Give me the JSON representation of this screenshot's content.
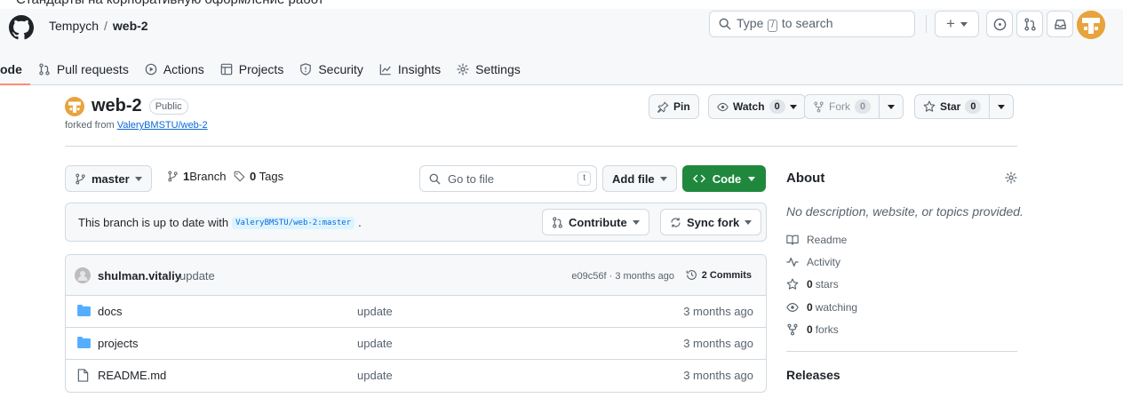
{
  "top_strip": {
    "text": "Стандарты на корпоративную оформление работ"
  },
  "header": {
    "owner": "Tempych",
    "separator": "/",
    "repo": "web-2",
    "search": {
      "prefix": "Type",
      "key": "/",
      "suffix": "to search"
    },
    "create_button": "+"
  },
  "nav": {
    "items": [
      {
        "label": "ode",
        "icon": "code-icon",
        "active": true
      },
      {
        "label": "Pull requests",
        "icon": "pull-request-icon"
      },
      {
        "label": "Actions",
        "icon": "play-icon"
      },
      {
        "label": "Projects",
        "icon": "table-icon"
      },
      {
        "label": "Security",
        "icon": "shield-icon"
      },
      {
        "label": "Insights",
        "icon": "graph-icon"
      },
      {
        "label": "Settings",
        "icon": "gear-icon"
      }
    ]
  },
  "repo": {
    "name": "web-2",
    "visibility": "Public",
    "forked_prefix": "forked from",
    "forked_from": "ValeryBMSTU/web-2",
    "pin_label": "Pin",
    "watch_label": "Watch",
    "watch_count": "0",
    "fork_label": "Fork",
    "fork_count": "0",
    "star_label": "Star",
    "star_count": "0"
  },
  "toolbar": {
    "branch": "master",
    "branches_count": "1",
    "branches_label": "Branch",
    "tags_count": "0",
    "tags_label": "Tags",
    "goto_placeholder": "Go to file",
    "goto_key": "t",
    "add_file": "Add file",
    "code": "Code"
  },
  "branch_status": {
    "text": "This branch is up to date with",
    "ref": "ValeryBMSTU/web-2:master",
    "suffix": ".",
    "contribute": "Contribute",
    "sync": "Sync fork"
  },
  "latest_commit": {
    "author": "shulman.vitaliy",
    "message": "update",
    "sha_time": "e09c56f · 3 months ago",
    "commits": "2 Commits"
  },
  "files": [
    {
      "type": "folder",
      "name": "docs",
      "message": "update",
      "date": "3 months ago"
    },
    {
      "type": "folder",
      "name": "projects",
      "message": "update",
      "date": "3 months ago"
    },
    {
      "type": "file",
      "name": "README.md",
      "message": "update",
      "date": "3 months ago"
    }
  ],
  "about": {
    "title": "About",
    "description": "No description, website, or topics provided.",
    "readme": "Readme",
    "activity": "Activity",
    "stars_count": "0",
    "stars_label": "stars",
    "watching_count": "0",
    "watching_label": "watching",
    "forks_count": "0",
    "forks_label": "forks",
    "releases": "Releases"
  },
  "colors": {
    "accent_green": "#1f883d",
    "link_blue": "#0969da",
    "folder_blue": "#54aeff",
    "tab_underline": "#fd8c73"
  }
}
